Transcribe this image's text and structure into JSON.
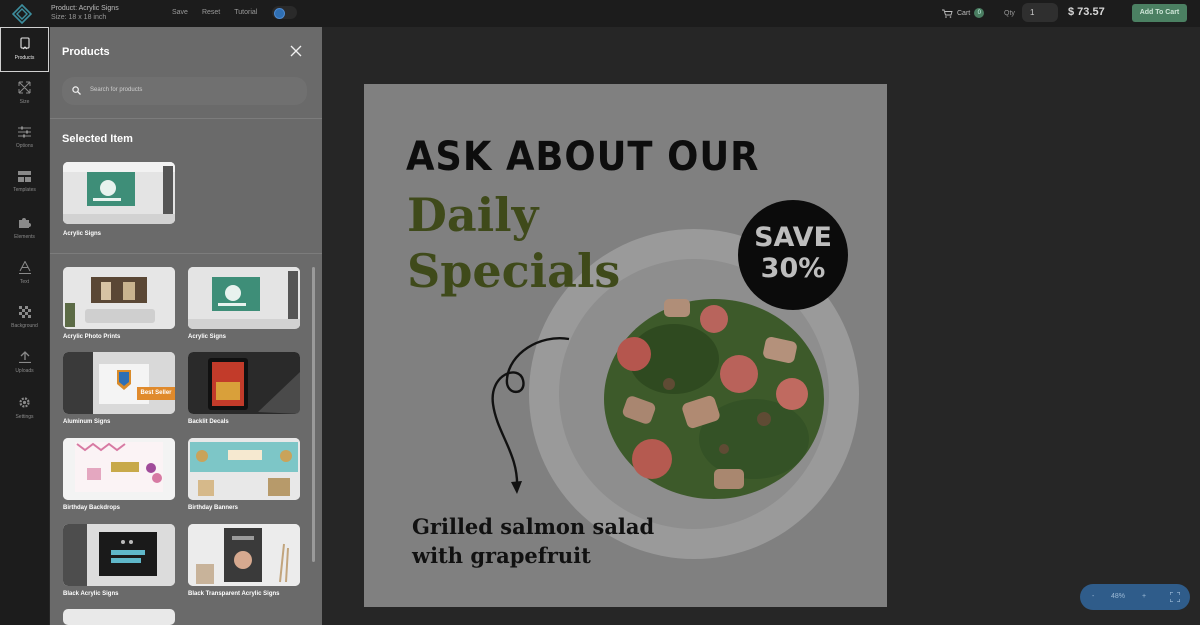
{
  "topbar": {
    "product": "Product: Acrylic Signs",
    "size": "Size: 18 x 18 inch",
    "save": "Save",
    "reset": "Reset",
    "tutorial": "Tutorial",
    "cart": "Cart",
    "cart_count": "0",
    "qty_label": "Qty",
    "qty_value": "1",
    "price": "$ 73.57",
    "add_to_cart": "Add To Cart"
  },
  "rail": {
    "items": [
      {
        "label": "Products",
        "icon": "products-icon"
      },
      {
        "label": "Size",
        "icon": "resize-icon"
      },
      {
        "label": "Options",
        "icon": "options-icon"
      },
      {
        "label": "Templates",
        "icon": "templates-icon"
      },
      {
        "label": "Elements",
        "icon": "puzzle-icon"
      },
      {
        "label": "Text",
        "icon": "text-icon"
      },
      {
        "label": "Background",
        "icon": "background-icon"
      },
      {
        "label": "Uploads",
        "icon": "upload-icon"
      },
      {
        "label": "Settings",
        "icon": "gear-icon"
      }
    ]
  },
  "panel": {
    "title": "Products",
    "search_placeholder": "Search for products",
    "selected_title": "Selected Item",
    "selected_item": "Acrylic Signs",
    "products": [
      {
        "label": "Acrylic Photo Prints"
      },
      {
        "label": "Acrylic Signs"
      },
      {
        "label": "Aluminum Signs",
        "badge": "Best Seller"
      },
      {
        "label": "Backlit Decals"
      },
      {
        "label": "Birthday Backdrops"
      },
      {
        "label": "Birthday Banners"
      },
      {
        "label": "Black Acrylic Signs"
      },
      {
        "label": "Black Transparent Acrylic Signs"
      }
    ]
  },
  "design": {
    "line1": "ASK ABOUT OUR",
    "line2": "Daily",
    "line3": "Specials",
    "save1": "SAVE",
    "save2": "30%",
    "dish1": "Grilled salmon salad",
    "dish2": "with grapefruit"
  },
  "zoom": {
    "minus": "-",
    "value": "48%",
    "plus": "+"
  },
  "colors": {
    "accent": "#4b8062",
    "zoom_bar": "#2f5c8a",
    "badge": "#e08a2c"
  }
}
